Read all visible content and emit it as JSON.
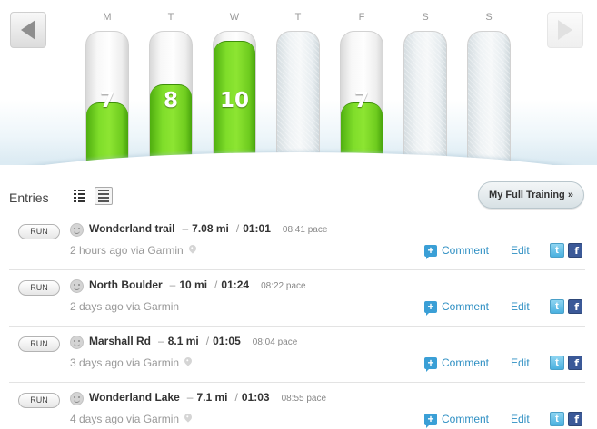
{
  "week": {
    "days": [
      {
        "letter": "M",
        "value": "7",
        "level": 0.41
      },
      {
        "letter": "T",
        "value": "8",
        "level": 0.56
      },
      {
        "letter": "W",
        "value": "10",
        "level": 0.91
      },
      {
        "letter": "T",
        "value": "",
        "level": 0
      },
      {
        "letter": "F",
        "value": "7",
        "level": 0.41
      },
      {
        "letter": "S",
        "value": "",
        "level": 0
      },
      {
        "letter": "S",
        "value": "",
        "level": 0
      }
    ],
    "prev_icon": "triangle-left-icon",
    "next_icon": "triangle-right-icon"
  },
  "entries_header": {
    "title": "Entries",
    "full_training_label": "My Full Training »"
  },
  "entries": [
    {
      "type": "RUN",
      "name": "Wonderland trail",
      "dist_sep": "–",
      "distance": "7.08 mi",
      "time_sep": "/",
      "duration": "01:01",
      "pace": "08:41 pace",
      "meta": "2 hours ago via Garmin",
      "comment_label": "Comment",
      "edit_label": "Edit"
    },
    {
      "type": "RUN",
      "name": "North Boulder",
      "dist_sep": "–",
      "distance": "10 mi",
      "time_sep": "/",
      "duration": "01:24",
      "pace": "08:22 pace",
      "meta": "2 days ago via Garmin",
      "comment_label": "Comment",
      "edit_label": "Edit"
    },
    {
      "type": "RUN",
      "name": "Marshall Rd",
      "dist_sep": "–",
      "distance": "8.1 mi",
      "time_sep": "/",
      "duration": "01:05",
      "pace": "08:04 pace",
      "meta": "3 days ago via Garmin",
      "comment_label": "Comment",
      "edit_label": "Edit"
    },
    {
      "type": "RUN",
      "name": "Wonderland Lake",
      "dist_sep": "–",
      "distance": "7.1 mi",
      "time_sep": "/",
      "duration": "01:03",
      "pace": "08:55 pace",
      "meta": "4 days ago via Garmin",
      "comment_label": "Comment",
      "edit_label": "Edit"
    }
  ],
  "social": {
    "twitter_glyph": "t",
    "facebook_glyph": "f"
  },
  "colors": {
    "accent_green": "#7fdd2a",
    "link_blue": "#2e8fc3",
    "facebook_blue": "#3b5998"
  }
}
